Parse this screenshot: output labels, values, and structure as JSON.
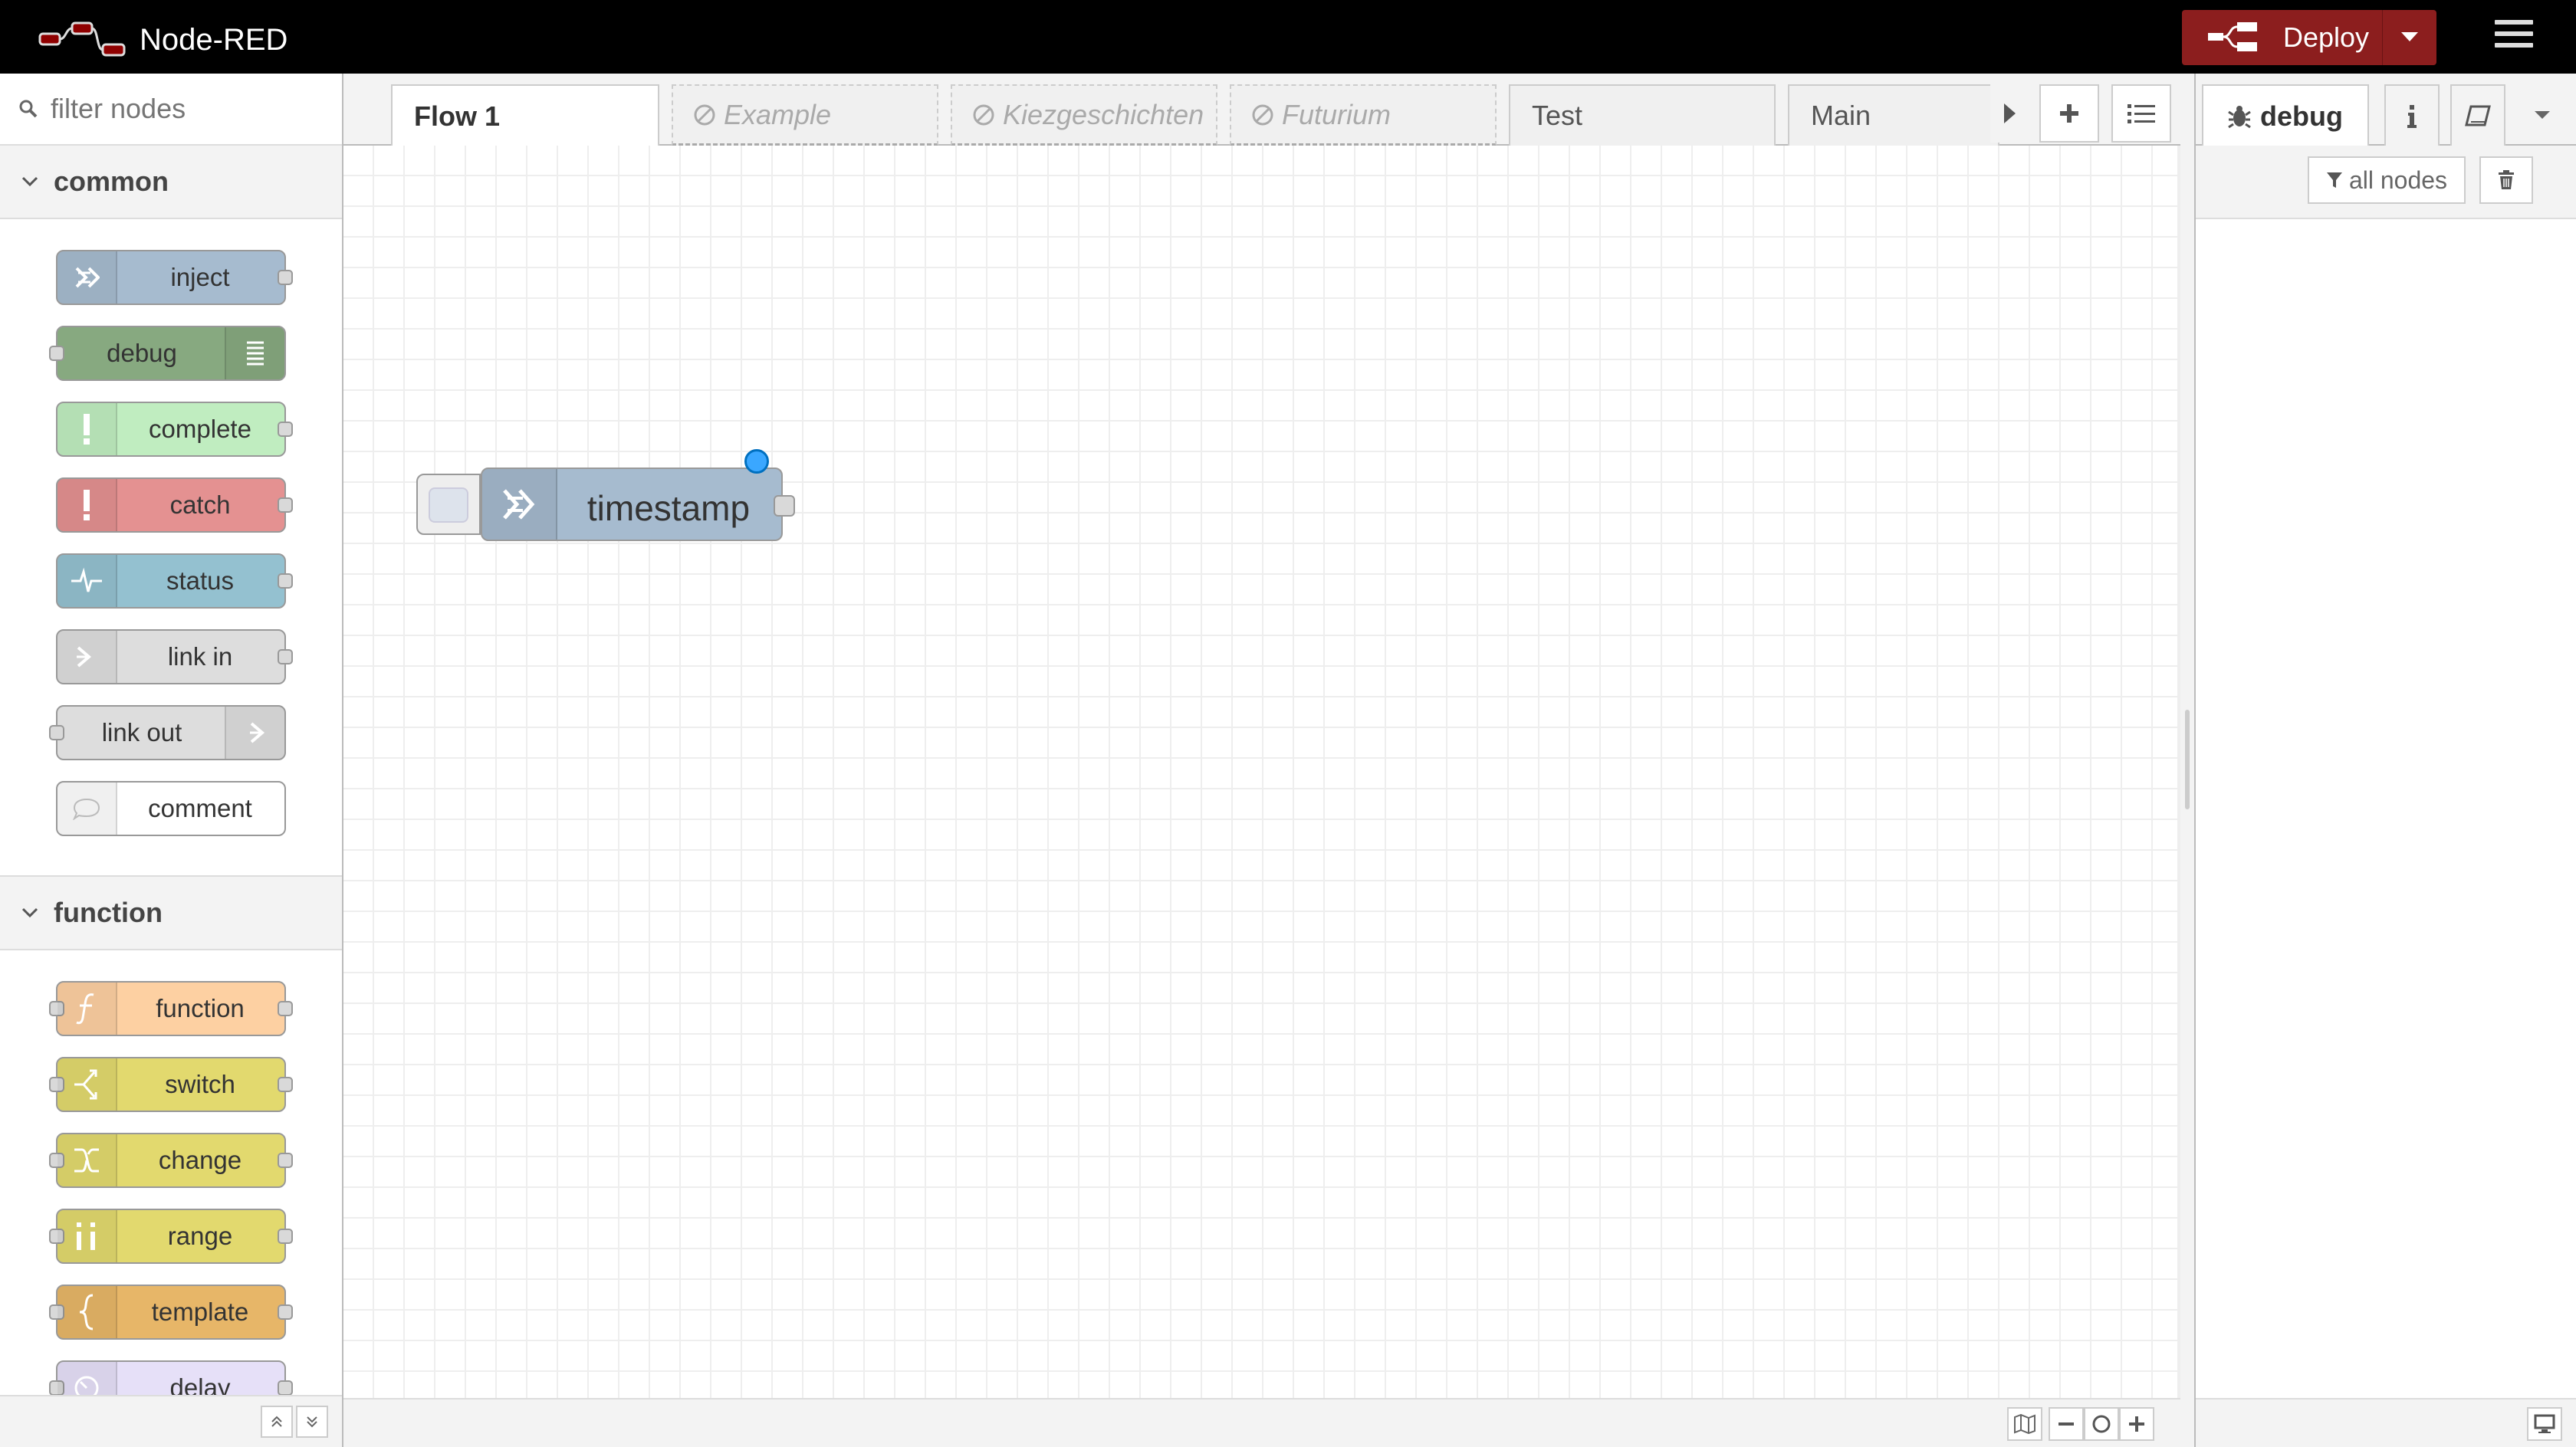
{
  "app": {
    "title": "Node-RED"
  },
  "header": {
    "deploy_label": "Deploy"
  },
  "palette": {
    "search_placeholder": "filter nodes",
    "categories": [
      {
        "title": "common",
        "nodes": [
          {
            "label": "inject",
            "color": "#a6bbcf",
            "icon": "arrow-in-icon"
          },
          {
            "label": "debug",
            "color": "#87a980",
            "icon": "list-icon"
          },
          {
            "label": "complete",
            "color": "#c0edc0",
            "icon": "exclamation-icon"
          },
          {
            "label": "catch",
            "color": "#e49191",
            "icon": "exclamation-icon"
          },
          {
            "label": "status",
            "color": "#94c1d0",
            "icon": "pulse-icon"
          },
          {
            "label": "link in",
            "color": "#dddddd",
            "icon": "link-in-icon"
          },
          {
            "label": "link out",
            "color": "#dddddd",
            "icon": "link-out-icon"
          },
          {
            "label": "comment",
            "color": "#ffffff",
            "icon": "comment-icon"
          }
        ]
      },
      {
        "title": "function",
        "nodes": [
          {
            "label": "function",
            "color": "#fdd0a2",
            "icon": "function-icon"
          },
          {
            "label": "switch",
            "color": "#e2d96e",
            "icon": "switch-icon"
          },
          {
            "label": "change",
            "color": "#e2d96e",
            "icon": "shuffle-icon"
          },
          {
            "label": "range",
            "color": "#e2d96e",
            "icon": "range-icon"
          },
          {
            "label": "template",
            "color": "#e7b668",
            "icon": "brace-icon"
          },
          {
            "label": "delay",
            "color": "#e6e0f8",
            "icon": "timer-icon"
          }
        ]
      }
    ]
  },
  "workspace": {
    "tabs": [
      {
        "label": "Flow 1",
        "state": "active"
      },
      {
        "label": "Example",
        "state": "disabled"
      },
      {
        "label": "Kiezgeschichten",
        "state": "disabled"
      },
      {
        "label": "Futurium",
        "state": "disabled"
      },
      {
        "label": "Test",
        "state": "normal"
      },
      {
        "label": "Main",
        "state": "normal"
      }
    ],
    "node": {
      "label": "timestamp",
      "color": "#a6bbcf"
    }
  },
  "sidebar": {
    "active_tab": "debug",
    "filter_label": "all nodes"
  }
}
